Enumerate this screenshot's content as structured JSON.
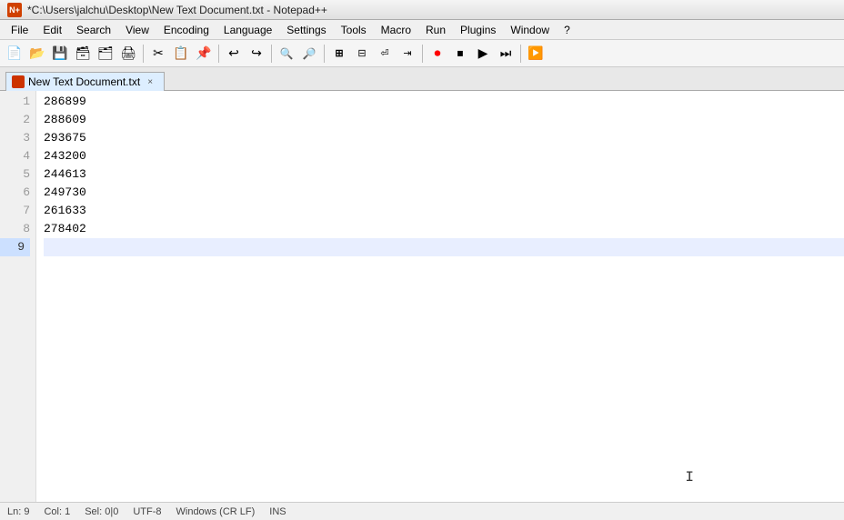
{
  "titlebar": {
    "title": "*C:\\Users\\jalchu\\Desktop\\New Text Document.txt - Notepad++",
    "appicon": "N++"
  },
  "menubar": {
    "items": [
      "File",
      "Edit",
      "Search",
      "View",
      "Encoding",
      "Language",
      "Settings",
      "Tools",
      "Macro",
      "Run",
      "Plugins",
      "Window",
      "?"
    ]
  },
  "toolbar": {
    "buttons": [
      {
        "name": "new",
        "icon": "📄"
      },
      {
        "name": "open",
        "icon": "📂"
      },
      {
        "name": "save",
        "icon": "💾"
      },
      {
        "name": "save-all",
        "icon": "🗂"
      },
      {
        "name": "close",
        "icon": "✖"
      },
      {
        "name": "print",
        "icon": "🖨"
      },
      {
        "name": "cut",
        "icon": "✂"
      },
      {
        "name": "copy",
        "icon": "📋"
      },
      {
        "name": "paste",
        "icon": "📌"
      },
      {
        "name": "undo",
        "icon": "↩"
      },
      {
        "name": "redo",
        "icon": "↪"
      },
      {
        "name": "find",
        "icon": "🔍"
      },
      {
        "name": "replace",
        "icon": "🔄"
      },
      {
        "name": "zoom-in",
        "icon": "+"
      },
      {
        "name": "zoom-out",
        "icon": "-"
      },
      {
        "name": "wrap",
        "icon": "⏎"
      },
      {
        "name": "indent",
        "icon": "⇥"
      },
      {
        "name": "macro-rec",
        "icon": "⏺"
      },
      {
        "name": "macro-stop",
        "icon": "⏹"
      },
      {
        "name": "macro-play",
        "icon": "▶"
      },
      {
        "name": "macro-skip",
        "icon": "⏭"
      },
      {
        "name": "run",
        "icon": "🚀"
      }
    ]
  },
  "tab": {
    "filename": "New Text Document.txt",
    "close_label": "×",
    "modified": true
  },
  "editor": {
    "lines": [
      {
        "num": 1,
        "content": "286899"
      },
      {
        "num": 2,
        "content": "288609"
      },
      {
        "num": 3,
        "content": "293675"
      },
      {
        "num": 4,
        "content": "243200"
      },
      {
        "num": 5,
        "content": "244613"
      },
      {
        "num": 6,
        "content": "249730"
      },
      {
        "num": 7,
        "content": "261633"
      },
      {
        "num": 8,
        "content": "278402"
      },
      {
        "num": 9,
        "content": ""
      }
    ]
  },
  "statusbar": {
    "ln": "Ln: 9",
    "col": "Col: 1",
    "sel": "Sel: 0|0",
    "encoding": "UTF-8",
    "eol": "Windows (CR LF)",
    "ins": "INS"
  }
}
